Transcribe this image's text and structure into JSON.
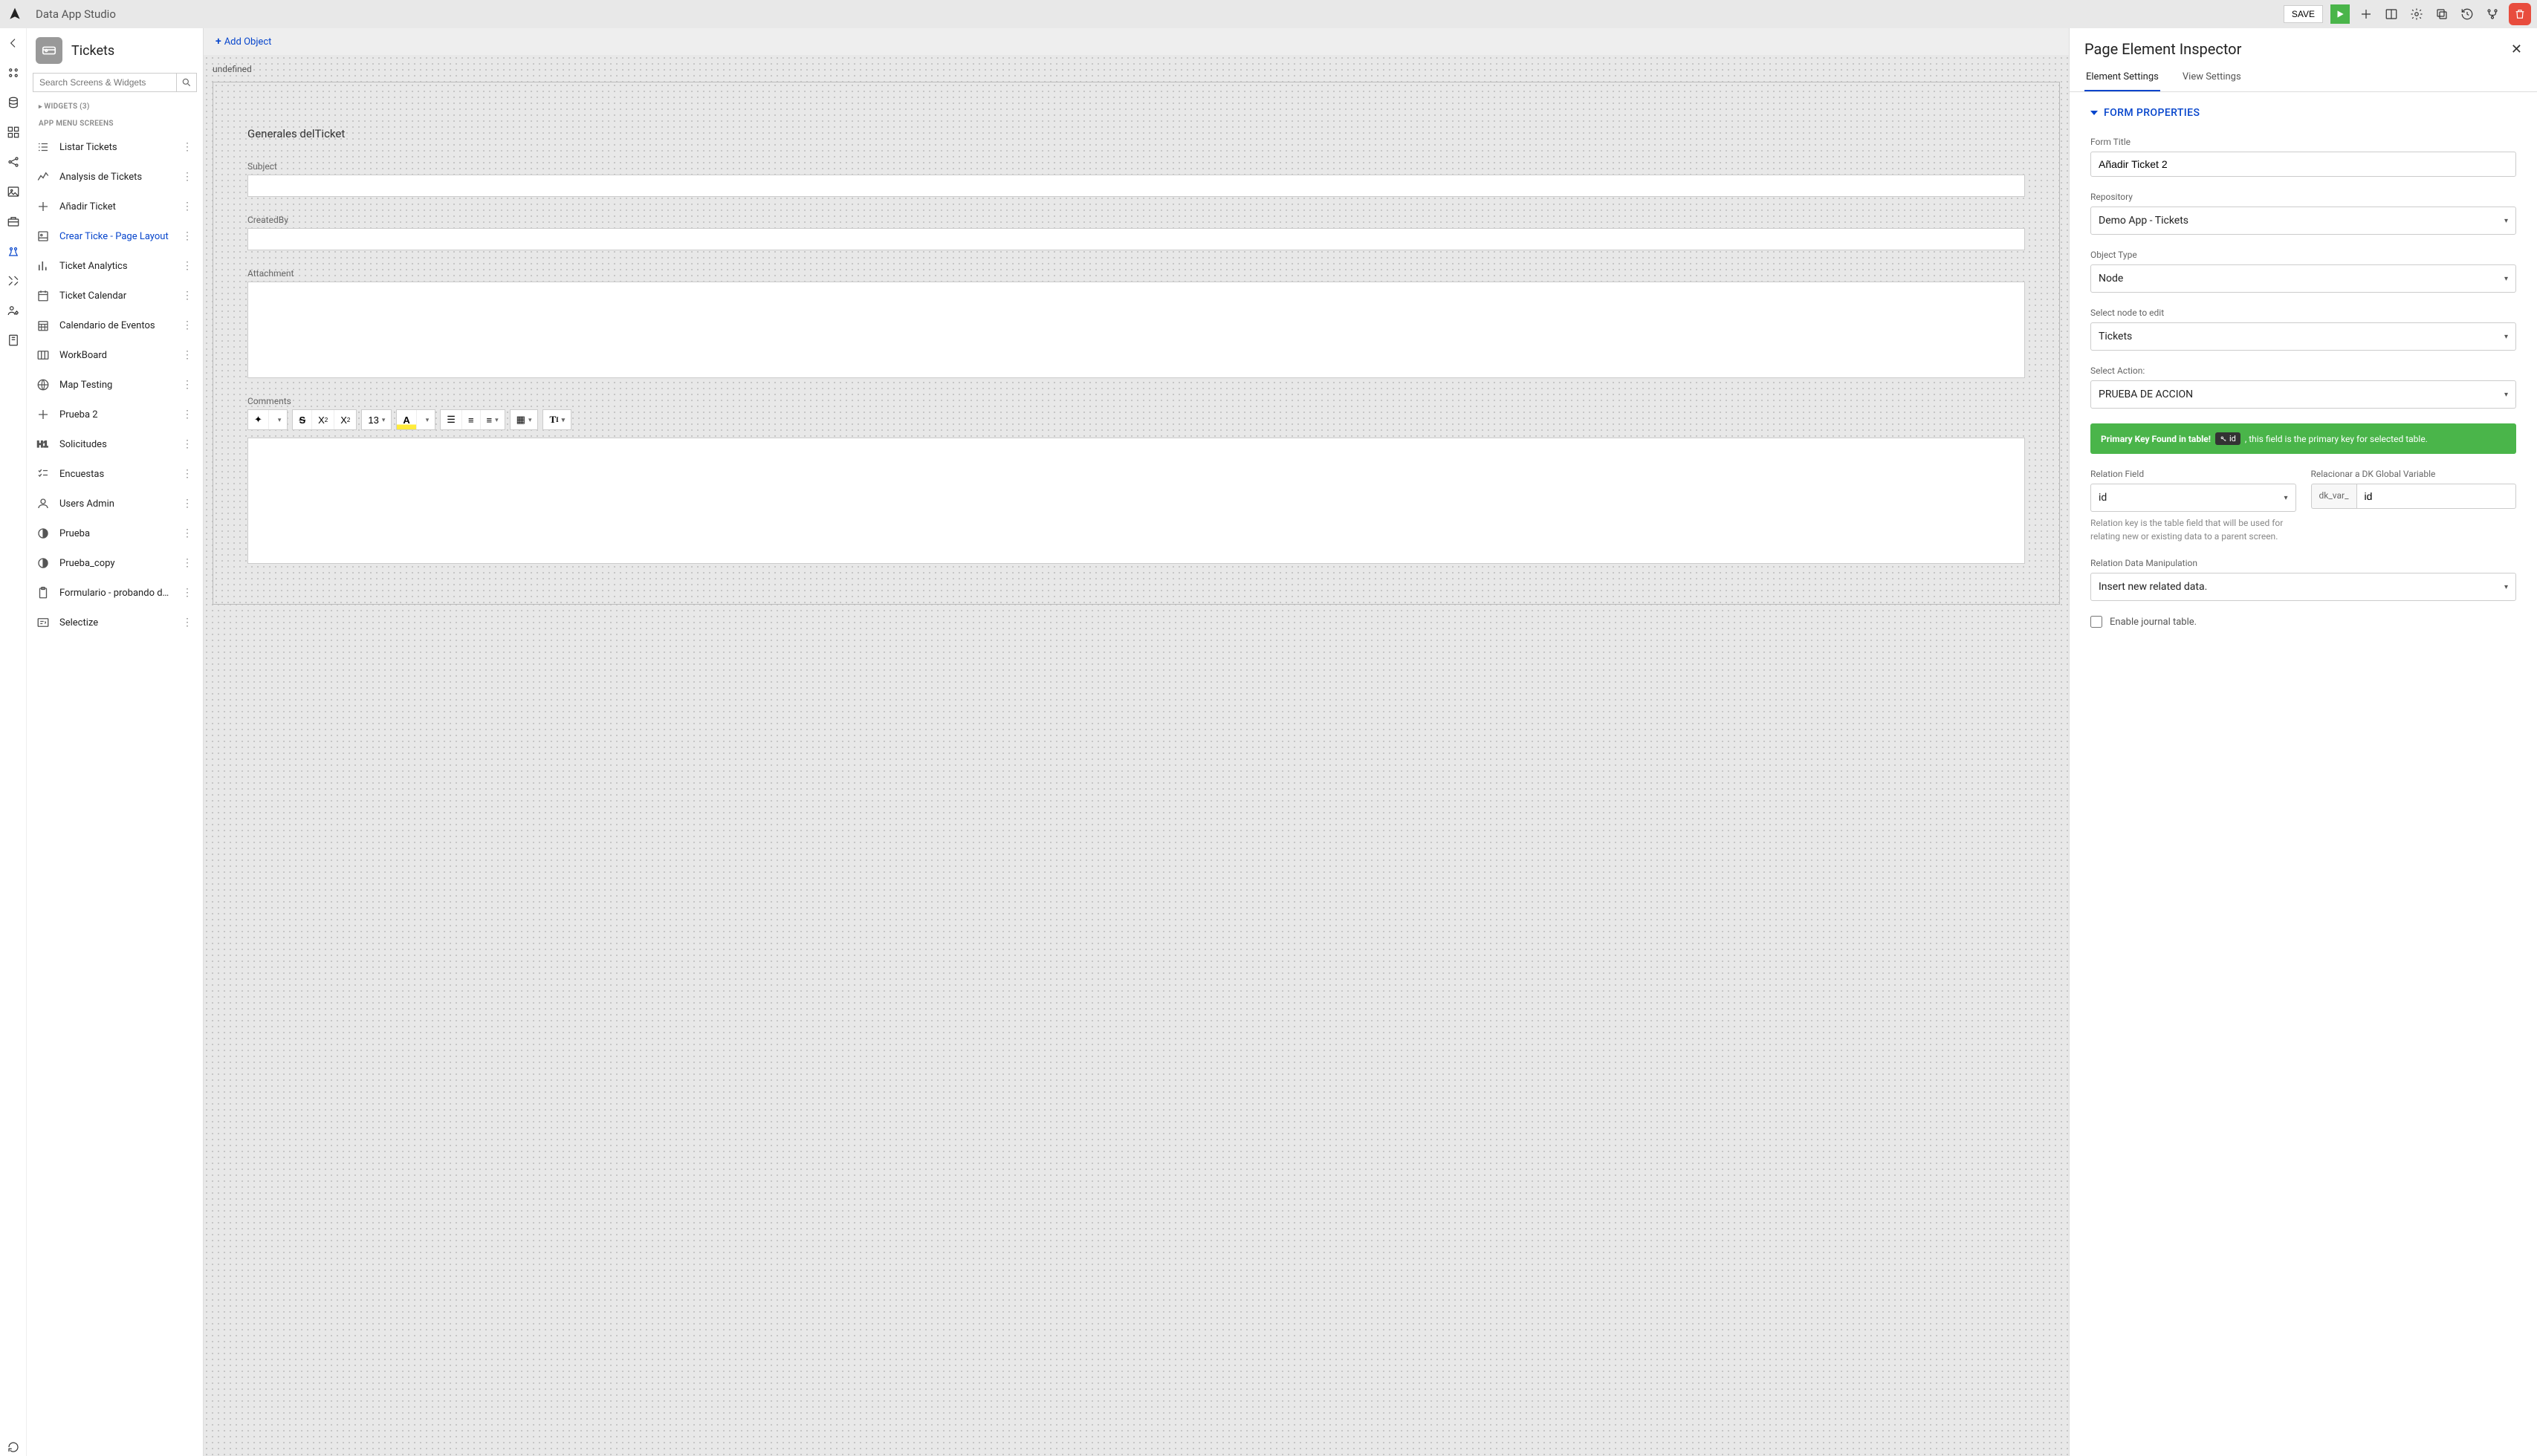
{
  "app_title": "Data App Studio",
  "topbar": {
    "save": "SAVE"
  },
  "sidebar": {
    "title": "Tickets",
    "search_placeholder": "Search Screens & Widgets",
    "widgets_label": "WIDGETS (3)",
    "screens_label": "APP MENU SCREENS",
    "items": [
      {
        "icon": "list",
        "label": "Listar Tickets"
      },
      {
        "icon": "chart",
        "label": "Analysis de Tickets"
      },
      {
        "icon": "plus",
        "label": "Añadir Ticket"
      },
      {
        "icon": "layout",
        "label": "Crear Ticke - Page Layout",
        "active": true
      },
      {
        "icon": "bar",
        "label": "Ticket Analytics"
      },
      {
        "icon": "calendar",
        "label": "Ticket Calendar"
      },
      {
        "icon": "calgrid",
        "label": "Calendario de Eventos"
      },
      {
        "icon": "board",
        "label": "WorkBoard"
      },
      {
        "icon": "globe",
        "label": "Map Testing"
      },
      {
        "icon": "plus",
        "label": "Prueba 2"
      },
      {
        "icon": "h1",
        "label": "Solicitudes"
      },
      {
        "icon": "checklist",
        "label": "Encuestas"
      },
      {
        "icon": "user",
        "label": "Users Admin"
      },
      {
        "icon": "half",
        "label": "Prueba"
      },
      {
        "icon": "half",
        "label": "Prueba_copy"
      },
      {
        "icon": "clip",
        "label": "Formulario - probando details"
      },
      {
        "icon": "select",
        "label": "Selectize"
      }
    ]
  },
  "canvas": {
    "add_object": "Add Object",
    "undefined": "undefined",
    "form_section_title": "Generales delTicket",
    "fields": {
      "subject": "Subject",
      "createdby": "CreatedBy",
      "attachment": "Attachment",
      "comments": "Comments"
    },
    "font_size": "13"
  },
  "inspector": {
    "title": "Page Element Inspector",
    "tabs": {
      "element": "Element Settings",
      "view": "View Settings"
    },
    "section": "FORM PROPERTIES",
    "form_title_label": "Form Title",
    "form_title_value": "Añadir Ticket 2",
    "repository_label": "Repository",
    "repository_value": "Demo App - Tickets",
    "object_type_label": "Object Type",
    "object_type_value": "Node",
    "select_node_label": "Select node to edit",
    "select_node_value": "Tickets",
    "select_action_label": "Select Action:",
    "select_action_value": "PRUEBA DE ACCION",
    "pk_banner_pre": "Primary Key Found in table!",
    "pk_badge": "id",
    "pk_banner_post": ", this field is the primary key for selected table.",
    "relation_field_label": "Relation Field",
    "relation_field_value": "id",
    "dk_var_label": "Relacionar a DK Global Variable",
    "dk_prefix": "dk_var_",
    "dk_value": "id",
    "relation_help": "Relation key is the table field that will be used for relating new or existing data to a parent screen.",
    "relation_manip_label": "Relation Data Manipulation",
    "relation_manip_value": "Insert new related data.",
    "enable_journal": "Enable journal table."
  }
}
